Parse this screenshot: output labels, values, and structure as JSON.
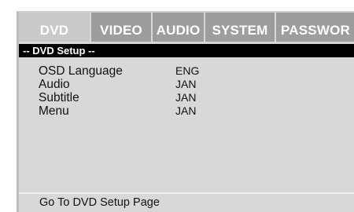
{
  "tabs": [
    {
      "label": "DVD",
      "active": true
    },
    {
      "label": "VIDEO",
      "active": false
    },
    {
      "label": "AUDIO",
      "active": false
    },
    {
      "label": "SYSTEM",
      "active": false
    },
    {
      "label": "PASSWOR",
      "active": false
    }
  ],
  "section_title": "-- DVD Setup --",
  "settings": [
    {
      "label": "OSD Language",
      "value": "ENG"
    },
    {
      "label": "Audio",
      "value": "JAN"
    },
    {
      "label": "Subtitle",
      "value": "JAN"
    },
    {
      "label": "Menu",
      "value": "JAN"
    }
  ],
  "status_text": "Go To DVD Setup Page",
  "colors": {
    "panel": "#d8d8d8",
    "tab_inactive": "#9d9d9d",
    "tab_active": "#c9c9c9",
    "header_bar": "#000000"
  }
}
